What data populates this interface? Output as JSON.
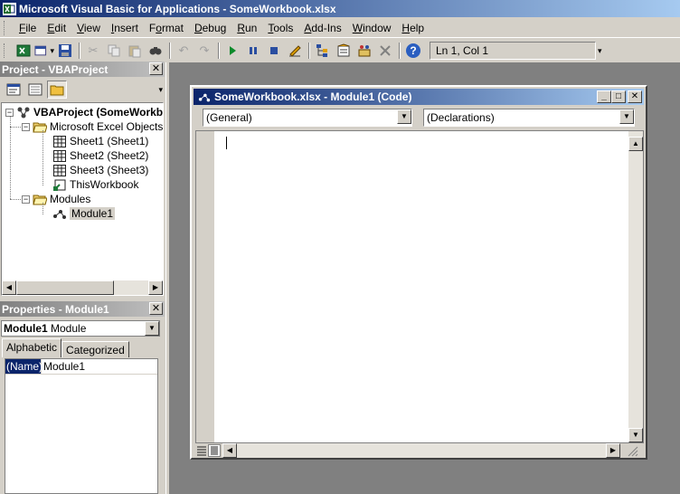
{
  "window": {
    "title": "Microsoft Visual Basic for Applications - SomeWorkbook.xlsx"
  },
  "menu": [
    {
      "label": "File",
      "key": "F"
    },
    {
      "label": "Edit",
      "key": "E"
    },
    {
      "label": "View",
      "key": "V"
    },
    {
      "label": "Insert",
      "key": "I"
    },
    {
      "label": "Format",
      "key": "o"
    },
    {
      "label": "Debug",
      "key": "D"
    },
    {
      "label": "Run",
      "key": "R"
    },
    {
      "label": "Tools",
      "key": "T"
    },
    {
      "label": "Add-Ins",
      "key": "A"
    },
    {
      "label": "Window",
      "key": "W"
    },
    {
      "label": "Help",
      "key": "H"
    }
  ],
  "toolbar": {
    "icons": [
      "view-excel-icon",
      "insert-module-icon",
      "save-icon",
      "cut-icon",
      "copy-icon",
      "paste-icon",
      "find-icon",
      "undo-icon",
      "redo-icon",
      "run-icon",
      "break-icon",
      "reset-icon",
      "design-mode-icon",
      "project-explorer-icon",
      "properties-window-icon",
      "object-browser-icon",
      "toolbox-icon",
      "help-icon"
    ],
    "status": "Ln 1, Col 1"
  },
  "project_pane": {
    "title": "Project - VBAProject",
    "tree": {
      "root": "VBAProject (SomeWorkb",
      "excel_objects_folder": "Microsoft Excel Objects",
      "sheets": [
        "Sheet1 (Sheet1)",
        "Sheet2 (Sheet2)",
        "Sheet3 (Sheet3)",
        "ThisWorkbook"
      ],
      "modules_folder": "Modules",
      "modules": [
        "Module1"
      ]
    }
  },
  "properties_pane": {
    "title": "Properties - Module1",
    "object_name": "Module1",
    "object_type": "Module",
    "tabs": [
      "Alphabetic",
      "Categorized"
    ],
    "rows": [
      {
        "name": "(Name)",
        "value": "Module1"
      }
    ]
  },
  "code_window": {
    "title": "SomeWorkbook.xlsx - Module1 (Code)",
    "object_combo": "(General)",
    "proc_combo": "(Declarations)"
  },
  "colors": {
    "title_active": "#0a246a",
    "title_inactive": "#808080",
    "chrome": "#d4d0c8",
    "mdi_bg": "#808080"
  }
}
